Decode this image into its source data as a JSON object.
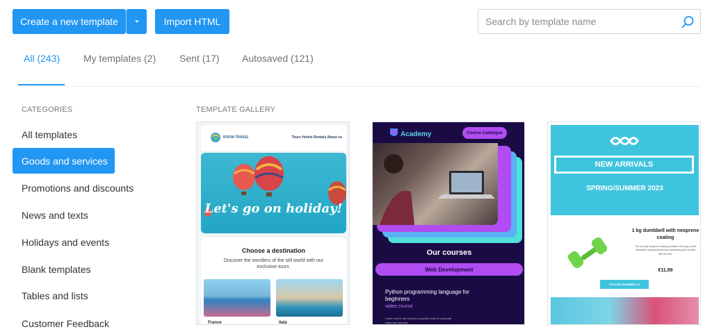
{
  "toolbar": {
    "create_label": "Create a new template",
    "import_label": "Import HTML"
  },
  "search": {
    "placeholder": "Search by template name"
  },
  "tabs": [
    {
      "label": "All (243)",
      "active": true
    },
    {
      "label": "My templates (2)",
      "active": false
    },
    {
      "label": "Sent (17)",
      "active": false
    },
    {
      "label": "Autosaved (121)",
      "active": false
    }
  ],
  "sidebar": {
    "heading": "CATEGORIES",
    "items": [
      {
        "label": "All templates",
        "active": false
      },
      {
        "label": "Goods and services",
        "active": true
      },
      {
        "label": "Promotions and discounts",
        "active": false
      },
      {
        "label": "News and texts",
        "active": false
      },
      {
        "label": "Holidays and events",
        "active": false
      },
      {
        "label": "Blank templates",
        "active": false
      },
      {
        "label": "Tables and lists",
        "active": false
      },
      {
        "label": "Customer Feedback",
        "active": false
      }
    ]
  },
  "gallery": {
    "heading": "TEMPLATE GALLERY",
    "cards": [
      {
        "brand": "IPSUM TRAVEL",
        "nav": "Tours  Hotels  Rentals  About us",
        "hero_text": "Let's go on holiday!",
        "title": "Choose a destination",
        "subtitle": "Discover the wonders of the old world with our exclusive tours.",
        "captions": [
          "France",
          "Italy"
        ]
      },
      {
        "logo_text": "Academy",
        "pill": "Course Catalogue",
        "title": "Our courses",
        "bar": "Web Development",
        "course": "Python programming language for beginners",
        "tag": "video course",
        "small": "Learn how to use Python's powerful tools to automate tasks and develop"
      },
      {
        "banner": "NEW ARRIVALS",
        "season": "SPRING/SUMMER 2023",
        "product": "1 kg dumbbell with neoprene coating",
        "description": "The non-slip neoprene coating provides a firm grip on the dumbbells during exercise and cushioning upon contact with the floor.",
        "price": "€11,99",
        "button": "CHOOSE DUMBBELLS"
      }
    ]
  },
  "colors": {
    "accent": "#2196f3",
    "academy_purple": "#b14cf2",
    "academy_bg": "#1a0b45",
    "arrivals_teal": "#3fc4de"
  }
}
